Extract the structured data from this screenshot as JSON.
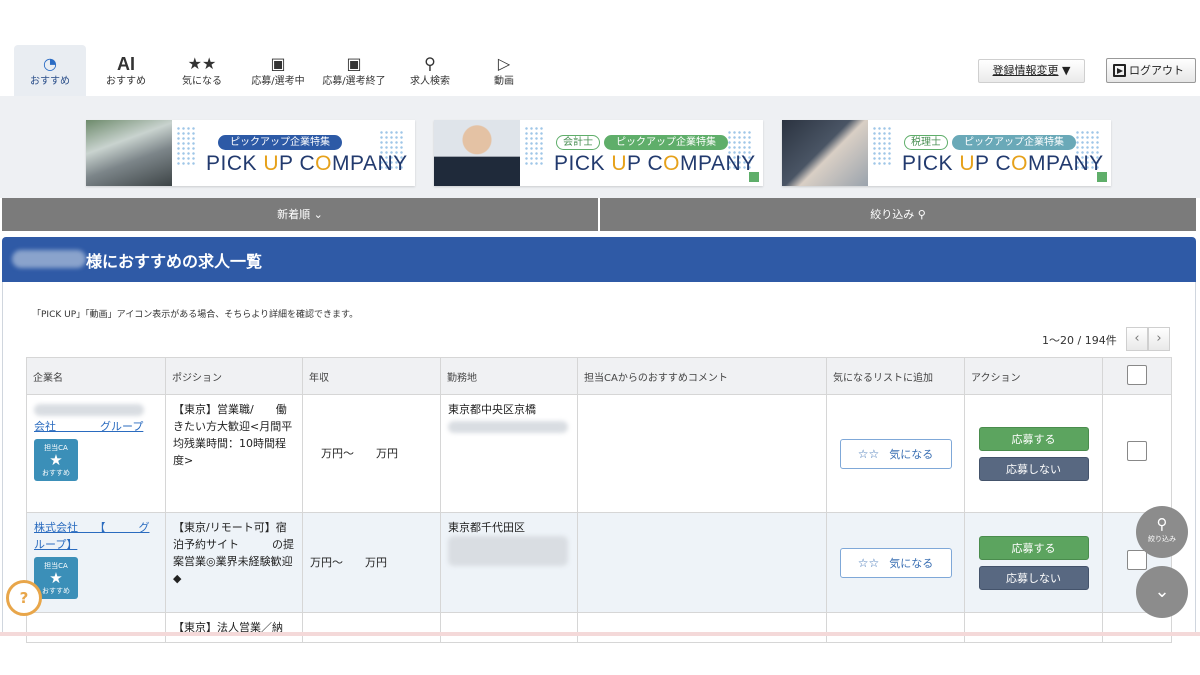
{
  "nav": {
    "tabs": [
      {
        "label": "おすすめ",
        "icon": "gauge-icon",
        "glyph": "◔"
      },
      {
        "label": "おすすめ",
        "icon": "ai-icon",
        "glyph": "AI"
      },
      {
        "label": "気になる",
        "icon": "stars-icon",
        "glyph": "★★"
      },
      {
        "label": "応募/選考中",
        "icon": "box-icon",
        "glyph": "▣"
      },
      {
        "label": "応募/選考終了",
        "icon": "box-icon",
        "glyph": "▣"
      },
      {
        "label": "求人検索",
        "icon": "search-icon",
        "glyph": "⚲"
      },
      {
        "label": "動画",
        "icon": "video-icon",
        "glyph": "▷"
      }
    ],
    "register_change": "登録情報変更",
    "register_arrow": "▼",
    "logout": "ログアウト"
  },
  "banners": [
    {
      "tags": [
        "ピックアップ企業特集"
      ],
      "title_pre": "PICK ",
      "title_u": "U",
      "title_mid": "P C",
      "title_o": "O",
      "title_post": "MPANY"
    },
    {
      "tags": [
        "会計士",
        "ピックアップ企業特集"
      ],
      "title_pre": "PICK ",
      "title_u": "U",
      "title_mid": "P C",
      "title_o": "O",
      "title_post": "MPANY"
    },
    {
      "tags": [
        "税理士",
        "ピックアップ企業特集"
      ],
      "title_pre": "PICK ",
      "title_u": "U",
      "title_mid": "P C",
      "title_o": "O",
      "title_post": "MPANY"
    }
  ],
  "sortbar": {
    "sort_label": "新着順",
    "sort_icon": "⌄",
    "filter_label": "絞り込み",
    "filter_icon": "⚲"
  },
  "panel": {
    "title": "様におすすめの求人一覧",
    "note": "「PICK UP」「動画」アイコン表示がある場合、そちらより詳細を確認できます。",
    "count": "1〜20 / 194件",
    "prev": "‹",
    "next": "›"
  },
  "table": {
    "headers": [
      "企業名",
      "ポジション",
      "年収",
      "勤務地",
      "担当CAからのおすすめコメント",
      "気になるリストに追加",
      "アクション",
      ""
    ],
    "rows": [
      {
        "company": "会社　　　　グループ",
        "position": "【東京】営業職/　　働きたい方大歓迎<月間平均残業時間：10時間程度>",
        "salary": "　万円〜　　万円",
        "location": "東京都中央区京橋",
        "comment": "",
        "badge_top": "担当CA",
        "badge_bottom": "おすすめ"
      },
      {
        "company": "株式会社　　【　　　グループ】",
        "position": "【東京/リモート可】宿泊予約サイト　　　の提案営業◎業界未経験歓迎◆",
        "salary": "万円〜　　万円",
        "location": "東京都千代田区",
        "comment": "",
        "badge_top": "担当CA",
        "badge_bottom": "おすすめ"
      },
      {
        "company": "",
        "position": "【東京】法人営業／納",
        "salary": "",
        "location": "",
        "comment": ""
      }
    ],
    "fav_label": "気になる",
    "fav_icon": "☆☆",
    "apply_label": "応募する",
    "decline_label": "応募しない"
  },
  "floating": {
    "search_label": "絞り込み",
    "search_icon": "⚲",
    "down_icon": "⌄",
    "help_icon": "?"
  }
}
